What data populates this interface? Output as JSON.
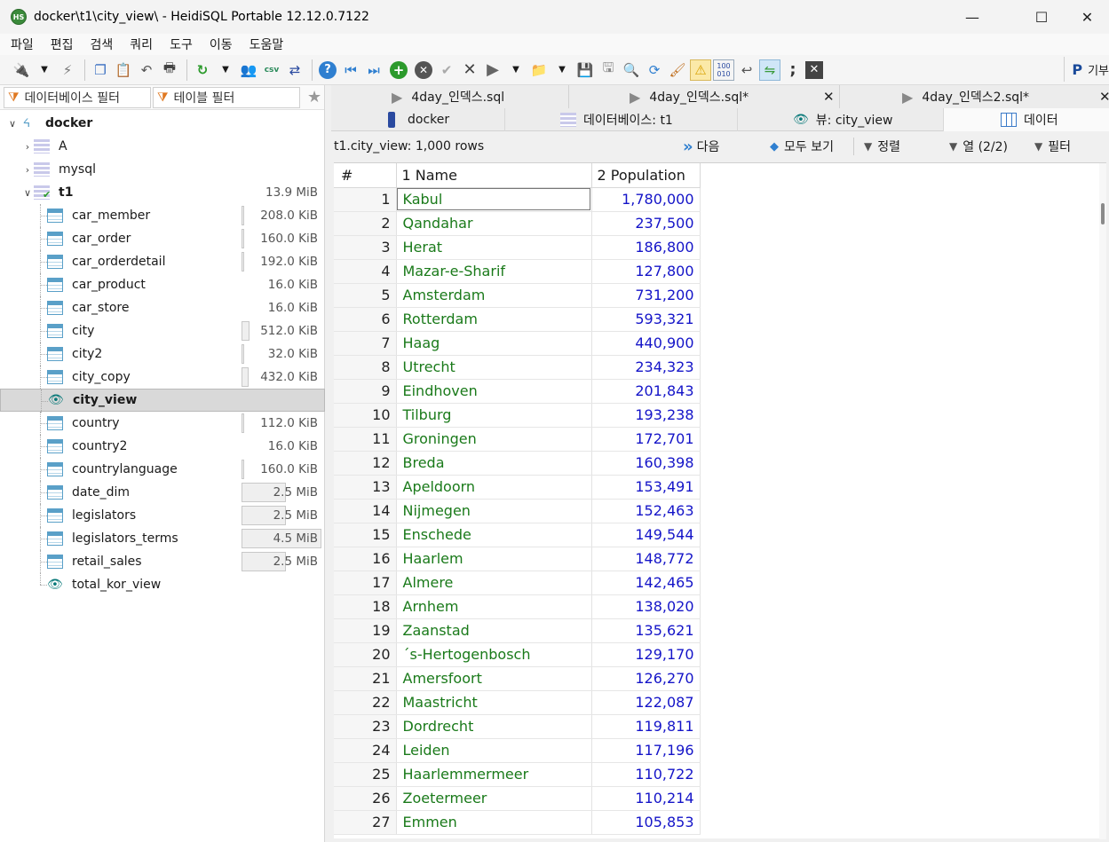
{
  "window": {
    "title": "docker\\t1\\city_view\\ - HeidiSQL Portable 12.12.0.7122",
    "app_icon": "HS",
    "minimize": "—",
    "maximize": "☐",
    "close": "✕"
  },
  "menu": [
    "파일",
    "편집",
    "검색",
    "쿼리",
    "도구",
    "이동",
    "도움말"
  ],
  "toolbar": {
    "donate_label": "기부"
  },
  "filters": {
    "db_filter": "데이터베이스 필터",
    "table_filter": "테이블 필터"
  },
  "tree": {
    "root": {
      "name": "docker"
    },
    "databases": [
      {
        "name": "A"
      },
      {
        "name": "mysql"
      },
      {
        "name": "t1",
        "size": "13.9 MiB"
      }
    ],
    "items": [
      {
        "name": "car_member",
        "size": "208.0 KiB",
        "kind": "table",
        "fill": 0.02
      },
      {
        "name": "car_order",
        "size": "160.0 KiB",
        "kind": "table",
        "fill": 0.02
      },
      {
        "name": "car_orderdetail",
        "size": "192.0 KiB",
        "kind": "table",
        "fill": 0.02
      },
      {
        "name": "car_product",
        "size": "16.0 KiB",
        "kind": "table",
        "fill": 0
      },
      {
        "name": "car_store",
        "size": "16.0 KiB",
        "kind": "table",
        "fill": 0
      },
      {
        "name": "city",
        "size": "512.0 KiB",
        "kind": "table",
        "fill": 0.1
      },
      {
        "name": "city2",
        "size": "32.0 KiB",
        "kind": "table",
        "fill": 0.01
      },
      {
        "name": "city_copy",
        "size": "432.0 KiB",
        "kind": "table",
        "fill": 0.09
      },
      {
        "name": "city_view",
        "size": "",
        "kind": "view",
        "fill": 0
      },
      {
        "name": "country",
        "size": "112.0 KiB",
        "kind": "table",
        "fill": 0.01
      },
      {
        "name": "country2",
        "size": "16.0 KiB",
        "kind": "table",
        "fill": 0
      },
      {
        "name": "countrylanguage",
        "size": "160.0 KiB",
        "kind": "table",
        "fill": 0.02
      },
      {
        "name": "date_dim",
        "size": "2.5 MiB",
        "kind": "table",
        "fill": 0.56
      },
      {
        "name": "legislators",
        "size": "2.5 MiB",
        "kind": "table",
        "fill": 0.56
      },
      {
        "name": "legislators_terms",
        "size": "4.5 MiB",
        "kind": "table",
        "fill": 1.0
      },
      {
        "name": "retail_sales",
        "size": "2.5 MiB",
        "kind": "table",
        "fill": 0.56
      },
      {
        "name": "total_kor_view",
        "size": "",
        "kind": "view",
        "fill": 0
      }
    ]
  },
  "query_tabs": [
    {
      "label": "4day_인덱스.sql"
    },
    {
      "label": "4day_인덱스.sql*"
    },
    {
      "label": "4day_인덱스2.sql*"
    }
  ],
  "view_tabs": [
    {
      "label": "docker"
    },
    {
      "label": "데이터베이스: t1"
    },
    {
      "label": "뷰: city_view"
    },
    {
      "label": "데이터"
    }
  ],
  "infobar": {
    "rows_text": "t1.city_view: 1,000 rows",
    "next": "다음",
    "show_all": "모두 보기",
    "sort": "정렬",
    "columns": "열 (2/2)",
    "filter": "필터"
  },
  "grid": {
    "headers": [
      "#",
      "1 Name",
      "2 Population"
    ],
    "rows": [
      [
        "1",
        "Kabul",
        "1,780,000"
      ],
      [
        "2",
        "Qandahar",
        "237,500"
      ],
      [
        "3",
        "Herat",
        "186,800"
      ],
      [
        "4",
        "Mazar-e-Sharif",
        "127,800"
      ],
      [
        "5",
        "Amsterdam",
        "731,200"
      ],
      [
        "6",
        "Rotterdam",
        "593,321"
      ],
      [
        "7",
        "Haag",
        "440,900"
      ],
      [
        "8",
        "Utrecht",
        "234,323"
      ],
      [
        "9",
        "Eindhoven",
        "201,843"
      ],
      [
        "10",
        "Tilburg",
        "193,238"
      ],
      [
        "11",
        "Groningen",
        "172,701"
      ],
      [
        "12",
        "Breda",
        "160,398"
      ],
      [
        "13",
        "Apeldoorn",
        "153,491"
      ],
      [
        "14",
        "Nijmegen",
        "152,463"
      ],
      [
        "15",
        "Enschede",
        "149,544"
      ],
      [
        "16",
        "Haarlem",
        "148,772"
      ],
      [
        "17",
        "Almere",
        "142,465"
      ],
      [
        "18",
        "Arnhem",
        "138,020"
      ],
      [
        "19",
        "Zaanstad",
        "135,621"
      ],
      [
        "20",
        "´s-Hertogenbosch",
        "129,170"
      ],
      [
        "21",
        "Amersfoort",
        "126,270"
      ],
      [
        "22",
        "Maastricht",
        "122,087"
      ],
      [
        "23",
        "Dordrecht",
        "119,811"
      ],
      [
        "24",
        "Leiden",
        "117,196"
      ],
      [
        "25",
        "Haarlemmermeer",
        "110,722"
      ],
      [
        "26",
        "Zoetermeer",
        "110,214"
      ],
      [
        "27",
        "Emmen",
        "105,853"
      ]
    ]
  }
}
